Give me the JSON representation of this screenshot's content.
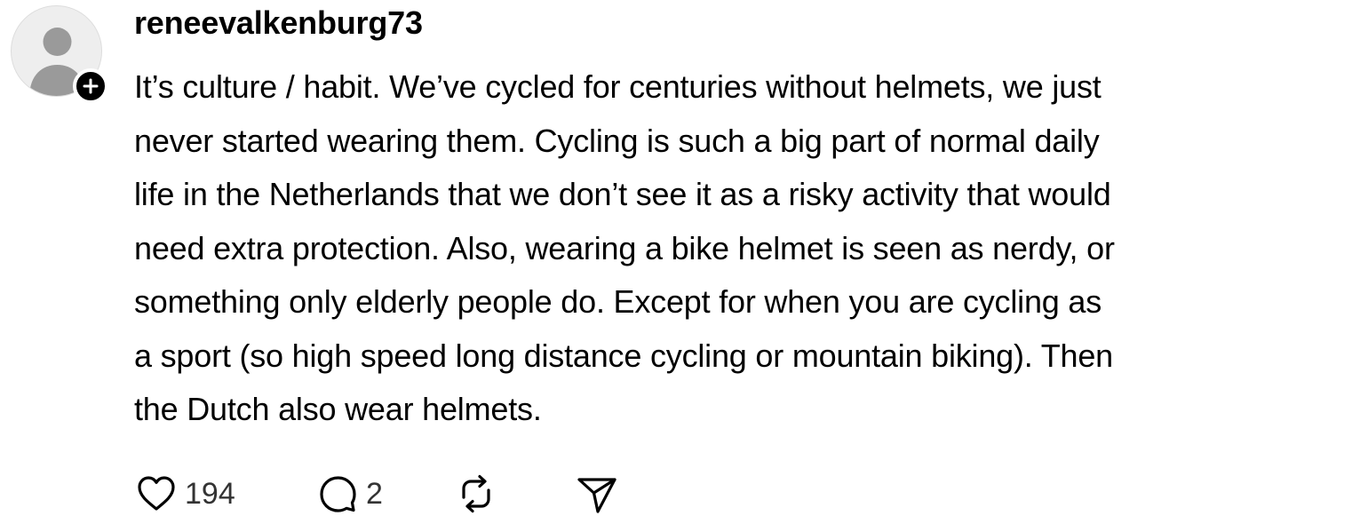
{
  "post": {
    "username": "reneevalkenburg73",
    "body_lines": [
      "It’s culture / habit. We’ve cycled for centuries without helmets, we just",
      "never started wearing them. Cycling is such a big part of normal daily",
      "life in the Netherlands that we don’t see it as a risky activity that would",
      "need extra protection. Also, wearing a bike helmet is seen as nerdy, or",
      "something only elderly people do. Except for when you are cycling as",
      "a sport (so high speed long distance cycling or mountain biking). Then",
      "the Dutch also wear helmets."
    ],
    "avatar_icon": "default-user-avatar-icon",
    "follow_icon": "plus-icon"
  },
  "actions": {
    "like": {
      "icon": "heart-icon",
      "count": "194"
    },
    "reply": {
      "icon": "comment-icon",
      "count": "2"
    },
    "repost": {
      "icon": "repost-icon"
    },
    "share": {
      "icon": "send-icon"
    }
  },
  "colors": {
    "text": "#000000",
    "count_text": "#333333",
    "avatar_bg": "#eeeeee",
    "avatar_figure": "#9a9a9a",
    "badge_bg": "#000000"
  }
}
